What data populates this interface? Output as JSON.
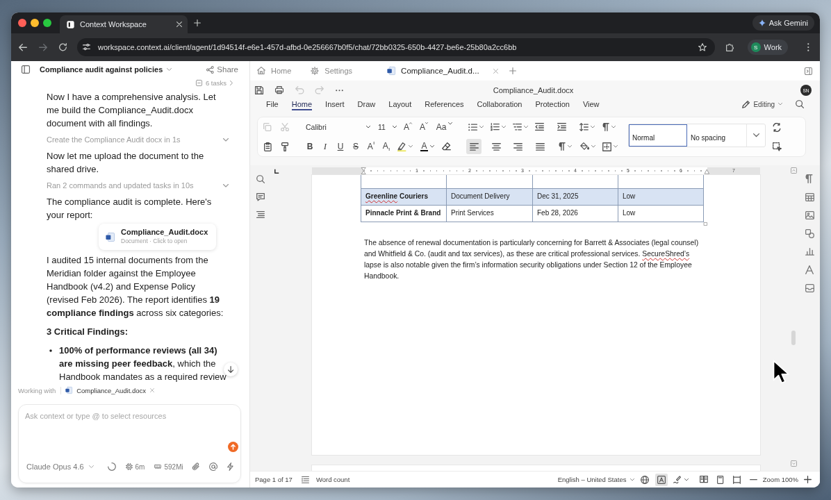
{
  "browser": {
    "tab": {
      "title": "Context Workspace"
    },
    "ask_gemini": "Ask Gemini",
    "nav": [
      {
        "kind": "back",
        "disabled": false
      },
      {
        "kind": "forward",
        "disabled": true
      },
      {
        "kind": "reload",
        "disabled": false
      }
    ],
    "url": "workspace.context.ai/client/agent/1d94514f-e6e1-457d-afbd-0e256667b0f5/chat/72bb0325-650b-4427-be6e-25b80a2cc6bb",
    "profile": {
      "initial": "S",
      "name": "Work"
    }
  },
  "chat": {
    "title": "Compliance audit against policies",
    "share": "Share",
    "tasks": "6 tasks",
    "messages": [
      {
        "kind": "text",
        "text": "Now I have a comprehensive analysis. Let me build the Compliance_Audit.docx document with all findings."
      },
      {
        "kind": "step",
        "text": "Create the Compliance Audit docx in 1s"
      },
      {
        "kind": "text",
        "text": "Now let me upload the document to the shared drive."
      },
      {
        "kind": "step",
        "text": "Ran 2 commands and updated tasks in 10s"
      },
      {
        "kind": "file",
        "text": "The compliance audit is complete. Here's your report:",
        "file": {
          "name": "Compliance_Audit.docx",
          "meta": "Document · Click to open"
        }
      },
      {
        "kind": "text",
        "text": "I audited 15 internal documents from the Meridian folder against the Employee Handbook (v4.2) and Expense Policy (revised Feb 2026). The report identifies **19 compliance findings** across six categories:"
      },
      {
        "kind": "heading",
        "text": "3 Critical Findings:"
      },
      {
        "kind": "bullet",
        "text": "**100% of performance reviews (all 34) are missing peer feedback**, which the Handbook mandates as a required review"
      }
    ],
    "working_with": {
      "label": "Working with",
      "file": "Compliance_Audit.docx"
    },
    "composer": {
      "placeholder": "Ask context or type @ to select resources",
      "model": "Claude Opus 4.6",
      "stats": [
        {
          "kind": "time",
          "text": "6m"
        },
        {
          "kind": "memory",
          "text": "592Mi"
        }
      ]
    }
  },
  "editor": {
    "tabs": [
      {
        "kind": "home",
        "label": "Home",
        "selected": false
      },
      {
        "kind": "settings",
        "label": "Settings",
        "selected": false
      },
      {
        "kind": "doc",
        "label": "Compliance_Audit.d...",
        "selected": true
      }
    ],
    "history": [
      {
        "kind": "undo",
        "disabled": true
      },
      {
        "kind": "redo",
        "disabled": true
      }
    ],
    "title": "Compliance_Audit.docx",
    "avatar": "SN",
    "menu": [
      {
        "label": "File",
        "selected": false
      },
      {
        "label": "Home",
        "selected": true
      },
      {
        "label": "Insert",
        "selected": false
      },
      {
        "label": "Draw",
        "selected": false
      },
      {
        "label": "Layout",
        "selected": false
      },
      {
        "label": "References",
        "selected": false
      },
      {
        "label": "Collaboration",
        "selected": false
      },
      {
        "label": "Protection",
        "selected": false
      },
      {
        "label": "View",
        "selected": false
      }
    ],
    "mode": "Editing",
    "ribbon": {
      "clipboard": [
        {
          "kind": "copy",
          "disabled": true
        },
        {
          "kind": "cut",
          "disabled": true
        }
      ],
      "font": "Calibri",
      "size": "11",
      "case_buttons": [
        {
          "kind": "grow",
          "label": "A"
        },
        {
          "kind": "shrink",
          "label": "A"
        },
        {
          "kind": "case",
          "label": "Aa"
        }
      ],
      "format_buttons": [
        {
          "kind": "bold",
          "label": "B"
        },
        {
          "kind": "italic",
          "label": "I"
        },
        {
          "kind": "underline",
          "label": "U"
        },
        {
          "kind": "strike",
          "label": "S"
        },
        {
          "kind": "superscript",
          "label": "A"
        },
        {
          "kind": "subscript",
          "label": "A"
        }
      ],
      "font_color": "A",
      "align_buttons": [
        {
          "kind": "left",
          "selected": true
        },
        {
          "kind": "center",
          "selected": false
        },
        {
          "kind": "right",
          "selected": false
        },
        {
          "kind": "justify",
          "selected": false
        }
      ],
      "styles": [
        {
          "label": "Normal",
          "selected": true
        },
        {
          "label": "No spacing",
          "selected": false
        }
      ]
    },
    "ruler": [
      "1",
      "2",
      "3",
      "4",
      "5",
      "6",
      "7"
    ],
    "table": {
      "rows": [
        {
          "selected": true,
          "cells": [
            {
              "parts": [
                {
                  "text": "Greenline",
                  "flagged": true
                },
                {
                  "text": " Couriers",
                  "flagged": false
                }
              ]
            },
            "Document Delivery",
            "Dec 31, 2025",
            "Low"
          ]
        },
        {
          "selected": false,
          "cells": [
            "Pinnacle Print & Brand",
            "Print Services",
            "Feb 28, 2026",
            "Low"
          ]
        }
      ]
    },
    "paragraph": [
      {
        "text": "The absence of renewal documentation is particularly concerning for Barrett & Associates (legal counsel) and Whitfield & Co. (audit and tax services), as these are critical professional services. ",
        "flagged": false
      },
      {
        "text": "SecureShred’s",
        "flagged": true
      },
      {
        "text": " lapse is also notable given the firm’s information security obligations under Section 12 of the Employee Handbook.",
        "flagged": false
      }
    ],
    "status": {
      "page": "Page 1 of 17",
      "word_count": "Word count",
      "language": "English – United States",
      "tools": [
        {
          "kind": "globe",
          "selected": false
        },
        {
          "kind": "proofing",
          "selected": true
        },
        {
          "kind": "pen",
          "selected": false
        }
      ],
      "zoom": "Zoom 100%"
    }
  }
}
